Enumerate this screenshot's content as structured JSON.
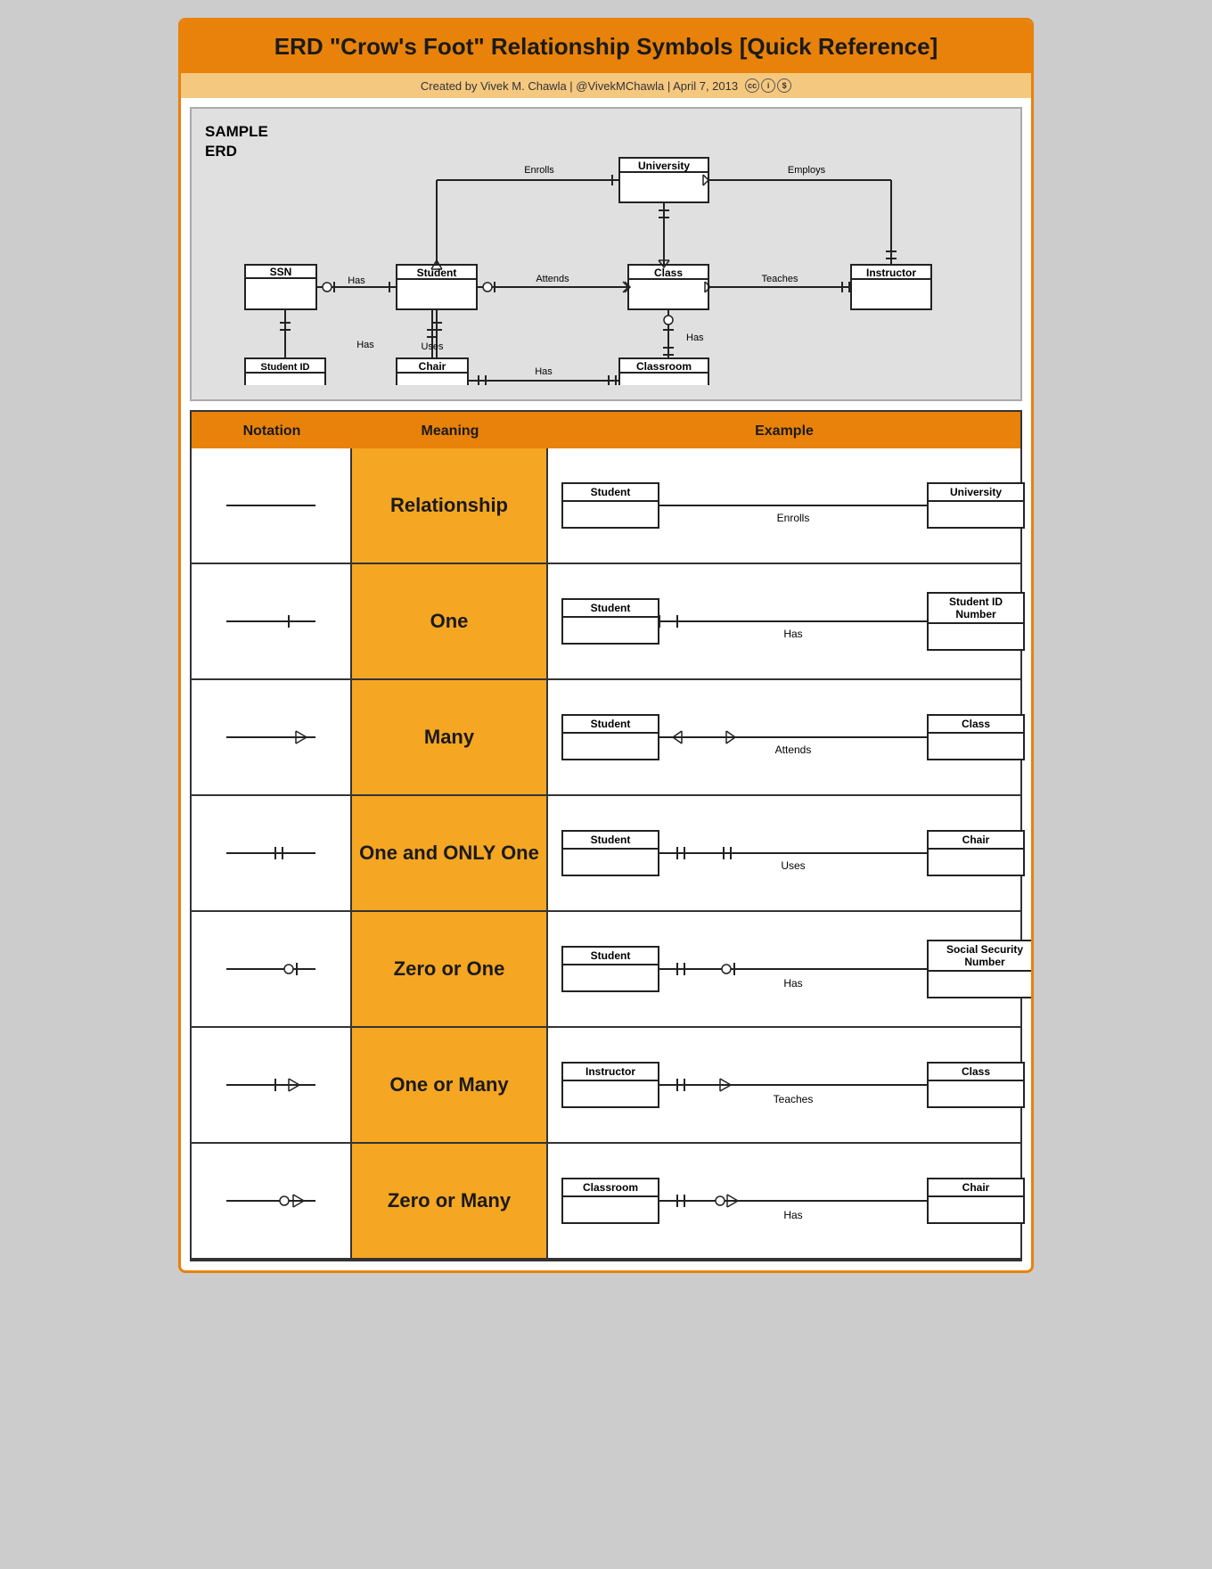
{
  "page": {
    "title": "ERD \"Crow's Foot\" Relationship Symbols [Quick Reference]",
    "subtitle": "Created by Vivek M. Chawla | @VivekMChawla | April 7, 2013",
    "erd_section_label": "SAMPLE\nERD"
  },
  "ref_header": {
    "col1": "Notation",
    "col2": "Meaning",
    "col3": "Example"
  },
  "rows": [
    {
      "meaning": "Relationship",
      "ex_left": "Student",
      "ex_right": "University",
      "ex_label": "Enrolls",
      "type": "relationship"
    },
    {
      "meaning": "One",
      "ex_left": "Student",
      "ex_right": "Student ID Number",
      "ex_label": "Has",
      "type": "one"
    },
    {
      "meaning": "Many",
      "ex_left": "Student",
      "ex_right": "Class",
      "ex_label": "Attends",
      "type": "many"
    },
    {
      "meaning": "One and ONLY One",
      "ex_left": "Student",
      "ex_right": "Chair",
      "ex_label": "Uses",
      "type": "one-only-one"
    },
    {
      "meaning": "Zero or One",
      "ex_left": "Student",
      "ex_right": "Social Security Number",
      "ex_label": "Has",
      "type": "zero-or-one"
    },
    {
      "meaning": "One or Many",
      "ex_left": "Instructor",
      "ex_right": "Class",
      "ex_label": "Teaches",
      "type": "one-or-many"
    },
    {
      "meaning": "Zero or Many",
      "ex_left": "Classroom",
      "ex_right": "Chair",
      "ex_label": "Has",
      "type": "zero-or-many"
    }
  ]
}
